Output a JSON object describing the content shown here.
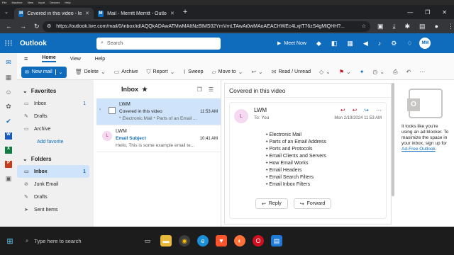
{
  "vm_menu": [
    "File",
    "Machine",
    "View",
    "Input",
    "Devices",
    "Help"
  ],
  "browser": {
    "tabs": [
      {
        "title": "Covered in this video - learnin",
        "active": true
      },
      {
        "title": "Mail - Merritt Merritt - Outlook",
        "active": false
      }
    ],
    "url": "https://outlook.live.com/mail/0/inbox/id/AQQkADAwATMwMAItNzBlMS02YmVmLTAwAi0wMAoAEACHWEc4LxjtT76zS4gMlQHH?..."
  },
  "outlook": {
    "brand": "Outlook",
    "search_placeholder": "Search",
    "meet_now": "Meet Now",
    "avatar": "MM",
    "ribbon_tabs": [
      "Home",
      "View",
      "Help"
    ],
    "commands": {
      "new_mail": "New mail",
      "delete": "Delete",
      "archive": "Archive",
      "report": "Report",
      "sweep": "Sweep",
      "move_to": "Move to",
      "read_unread": "Read / Unread"
    },
    "favorites": {
      "header": "Favorites",
      "items": [
        {
          "label": "Inbox",
          "count": "1"
        },
        {
          "label": "Drafts",
          "count": ""
        },
        {
          "label": "Archive",
          "count": ""
        }
      ],
      "add": "Add favorite"
    },
    "folders": {
      "header": "Folders",
      "items": [
        {
          "label": "Inbox",
          "count": "1"
        },
        {
          "label": "Junk Email",
          "count": ""
        },
        {
          "label": "Drafts",
          "count": ""
        },
        {
          "label": "Sent Items",
          "count": ""
        }
      ]
    },
    "list": {
      "title": "Inbox",
      "messages": [
        {
          "from": "LWM",
          "subject": "Covered in this video",
          "time": "11:53 AM",
          "preview": "* Electronic Mail * Parts of an Email ...",
          "avatar": "L"
        },
        {
          "from": "LWM",
          "subject": "Email Subject",
          "time": "10:41 AM",
          "preview": "Hello, This is some example email te...",
          "avatar": "L"
        }
      ]
    },
    "reading": {
      "subject": "Covered in this video",
      "sender": "LWM",
      "avatar": "L",
      "to_label": "To:",
      "to": "You",
      "date": "Mon 2/19/2024 11:53 AM",
      "bullets": [
        "Electronic Mail",
        "Parts of an Email Address",
        "Ports and Protocols",
        "Email Clients and Servers",
        "How Email Works",
        "Email Headers",
        "Email Search Filters",
        "Email Inbox Filters"
      ],
      "reply": "Reply",
      "forward": "Forward"
    },
    "ad": {
      "text": "It looks like you're using an ad blocker. To maximize the space in your inbox, sign up for",
      "link": "Ad-Free Outlook",
      "end": "."
    }
  },
  "taskbar": {
    "search_placeholder": "Type here to search"
  }
}
